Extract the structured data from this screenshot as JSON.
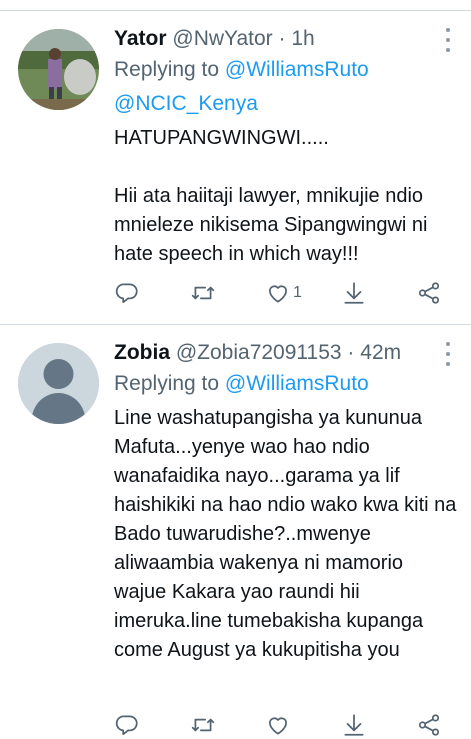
{
  "tweets": [
    {
      "name": "Yator",
      "handle": "@NwYator",
      "separator": "·",
      "time": "1h",
      "replying_prefix": "Replying to",
      "mentions": [
        "@WilliamsRuto",
        "@NCIC_Kenya"
      ],
      "text": "HATUPANGWINGWI.....\n\nHii ata haiitaji lawyer, mnikujie ndio mnieleze nikisema Sipangwingwi ni hate speech in which way!!!",
      "like_count": "1"
    },
    {
      "name": "Zobia",
      "handle": "@Zobia72091153",
      "separator": "·",
      "time": "42m",
      "replying_prefix": "Replying to",
      "mentions": [
        "@WilliamsRuto"
      ],
      "text": "Line washatupangisha ya kununua Mafuta...yenye wao hao ndio wanafaidika nayo...garama ya lif haishikiki na hao ndio wako kwa kiti na Bado tuwarudishe?..mwenye aliwaambia wakenya ni mamorio wajue Kakara yao raundi hii imeruka.line tumebakisha kupanga come August ya kukupitisha you",
      "like_count": ""
    }
  ],
  "icons": [
    "reply-icon",
    "retweet-icon",
    "like-icon",
    "download-icon",
    "share-icon",
    "more-icon"
  ],
  "colors": {
    "accent": "#1d9bf0",
    "secondary_text": "#536471",
    "divider": "#cfd9de",
    "icon": "#536471"
  }
}
